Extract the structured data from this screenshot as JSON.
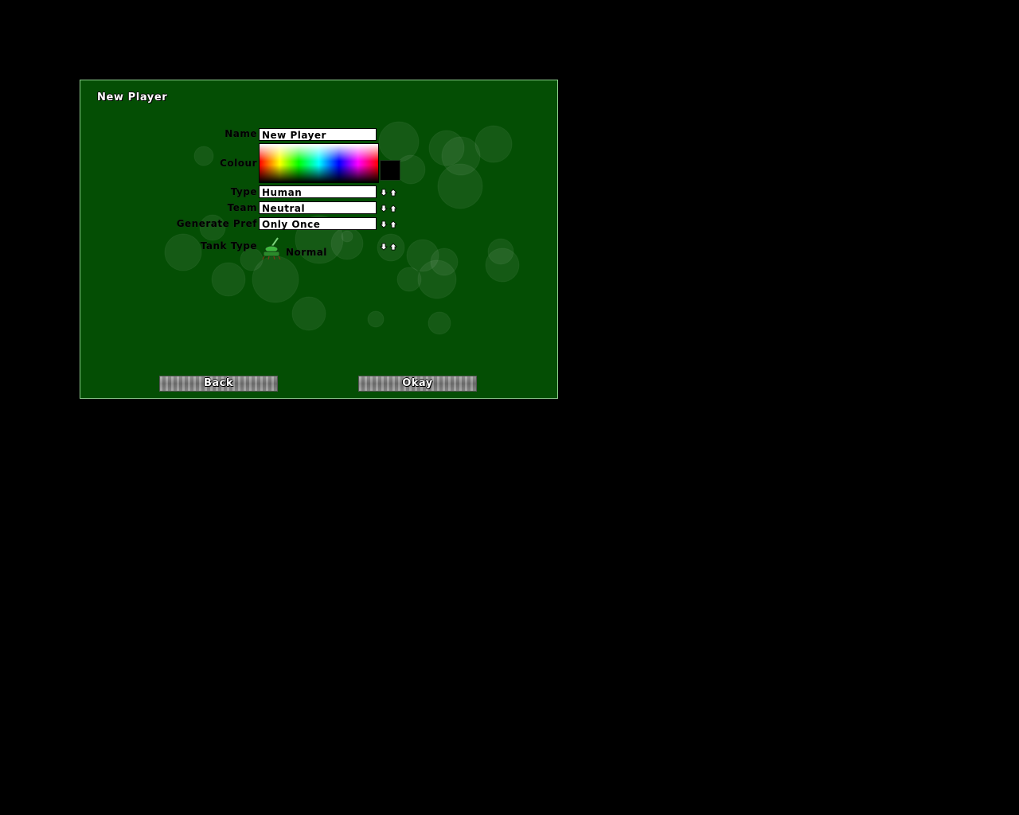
{
  "dialog": {
    "title": "New Player"
  },
  "form": {
    "name_label": "Name",
    "name_value": "New Player",
    "colour_label": "Colour",
    "selected_colour": "#000000",
    "type_label": "Type",
    "type_value": "Human",
    "team_label": "Team",
    "team_value": "Neutral",
    "generate_pref_label": "Generate Pref",
    "generate_pref_value": "Only Once",
    "tank_type_label": "Tank Type",
    "tank_type_value": "Normal",
    "tank_icon": "tank-icon"
  },
  "buttons": {
    "back_label": "Back",
    "okay_label": "Okay"
  },
  "colors": {
    "background": "#000000",
    "dialog_bg": "#044e04",
    "dialog_border": "#8fd08f"
  }
}
